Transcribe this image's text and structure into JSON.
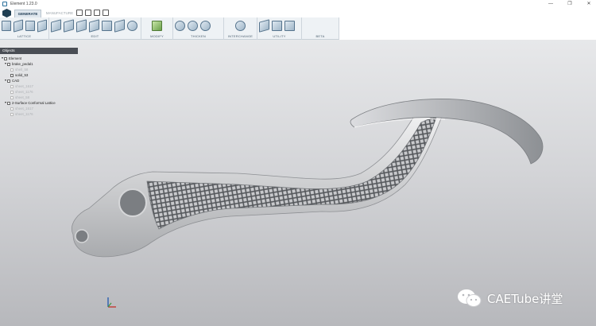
{
  "window": {
    "title": "Element 1.23.0",
    "minimize": "—",
    "maximize": "❐",
    "close": "✕"
  },
  "ribbon": {
    "tabs": [
      "GENERATE",
      "MANUFACTURE"
    ],
    "groups": [
      "LATTICE",
      "EDIT",
      "MODIFY",
      "THICKEN",
      "INTERCHANGE",
      "UTILITY",
      "BETA"
    ]
  },
  "objects": {
    "header": "Objects",
    "tree": [
      {
        "label": "Element",
        "level": 0,
        "dim": false
      },
      {
        "label": "brake_pedal1",
        "level": 1,
        "dim": false
      },
      {
        "label": "shell_58",
        "level": 2,
        "dim": true
      },
      {
        "label": "solid_53",
        "level": 2,
        "dim": false
      },
      {
        "label": "CAD",
        "level": 1,
        "dim": false
      },
      {
        "label": "sheet_1617",
        "level": 2,
        "dim": true
      },
      {
        "label": "sheet_1176",
        "level": 2,
        "dim": true
      },
      {
        "label": "sheet_58",
        "level": 2,
        "dim": true
      },
      {
        "label": "2-Surface Conformal Lattice",
        "level": 1,
        "dim": false
      },
      {
        "label": "sheet_1617",
        "level": 2,
        "dim": true
      },
      {
        "label": "sheet_1176",
        "level": 2,
        "dim": true
      }
    ]
  },
  "watermark": {
    "text": "CAETube讲堂"
  },
  "colors": {
    "ribbon_bg": "#eef2f5",
    "panel_header": "#4a4e55",
    "accent": "#1d3a52"
  }
}
